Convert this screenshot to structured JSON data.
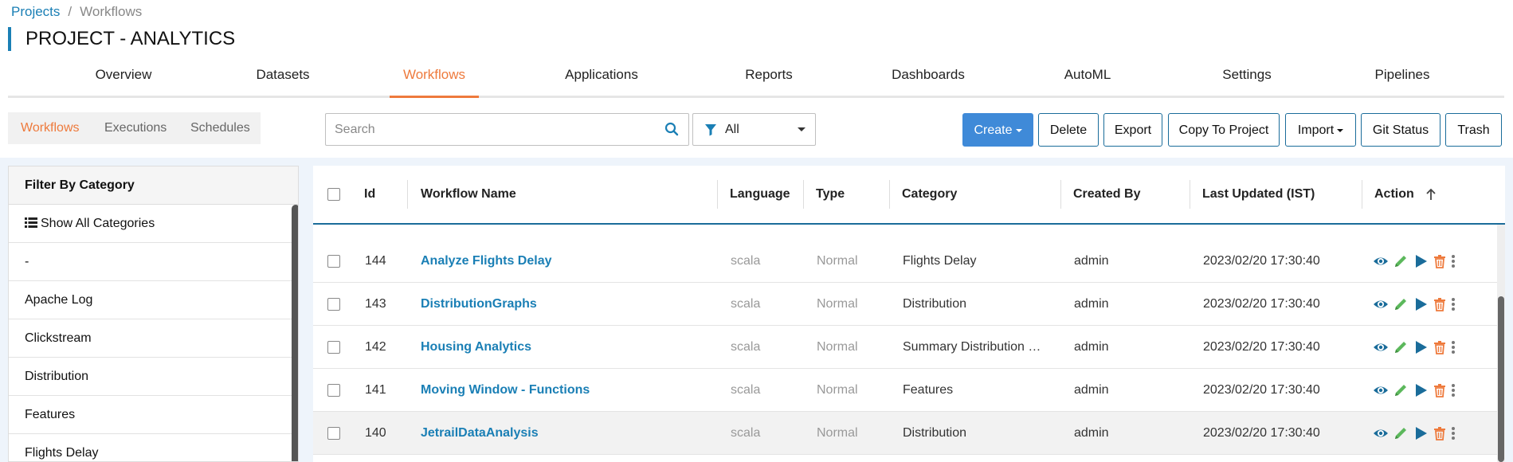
{
  "breadcrumb": {
    "root": "Projects",
    "separator": "/",
    "current": "Workflows"
  },
  "page_title": "PROJECT - ANALYTICS",
  "main_tabs": [
    "Overview",
    "Datasets",
    "Workflows",
    "Applications",
    "Reports",
    "Dashboards",
    "AutoML",
    "Settings",
    "Pipelines"
  ],
  "sub_tabs": [
    "Workflows",
    "Executions",
    "Schedules"
  ],
  "search": {
    "placeholder": "Search"
  },
  "filter": {
    "selected": "All"
  },
  "toolbar": {
    "create": "Create",
    "delete": "Delete",
    "export": "Export",
    "copy_to_project": "Copy To Project",
    "import": "Import",
    "git_status": "Git Status",
    "trash": "Trash"
  },
  "sidebar": {
    "header": "Filter By Category",
    "show_all": "Show All Categories",
    "categories": [
      "-",
      "Apache Log",
      "Clickstream",
      "Distribution",
      "Features",
      "Flights Delay"
    ]
  },
  "table": {
    "columns": {
      "id": "Id",
      "name": "Workflow Name",
      "language": "Language",
      "type": "Type",
      "category": "Category",
      "created_by": "Created By",
      "last_updated": "Last Updated (IST)",
      "action": "Action"
    },
    "rows": [
      {
        "id": "144",
        "name": "Analyze Flights Delay",
        "language": "scala",
        "type": "Normal",
        "category": "Flights Delay",
        "created_by": "admin",
        "last_updated": "2023/02/20 17:30:40"
      },
      {
        "id": "143",
        "name": "DistributionGraphs",
        "language": "scala",
        "type": "Normal",
        "category": "Distribution",
        "created_by": "admin",
        "last_updated": "2023/02/20 17:30:40"
      },
      {
        "id": "142",
        "name": "Housing Analytics",
        "language": "scala",
        "type": "Normal",
        "category": "Summary Distribution …",
        "created_by": "admin",
        "last_updated": "2023/02/20 17:30:40"
      },
      {
        "id": "141",
        "name": "Moving Window - Functions",
        "language": "scala",
        "type": "Normal",
        "category": "Features",
        "created_by": "admin",
        "last_updated": "2023/02/20 17:30:40"
      },
      {
        "id": "140",
        "name": "JetrailDataAnalysis",
        "language": "scala",
        "type": "Normal",
        "category": "Distribution",
        "created_by": "admin",
        "last_updated": "2023/02/20 17:30:40"
      }
    ]
  },
  "colors": {
    "accent": "#ee7a3c",
    "link": "#1a7fb5",
    "primary_button": "#3f8ad8",
    "edit_icon": "#5cb85c",
    "delete_icon": "#ee7a3c"
  }
}
